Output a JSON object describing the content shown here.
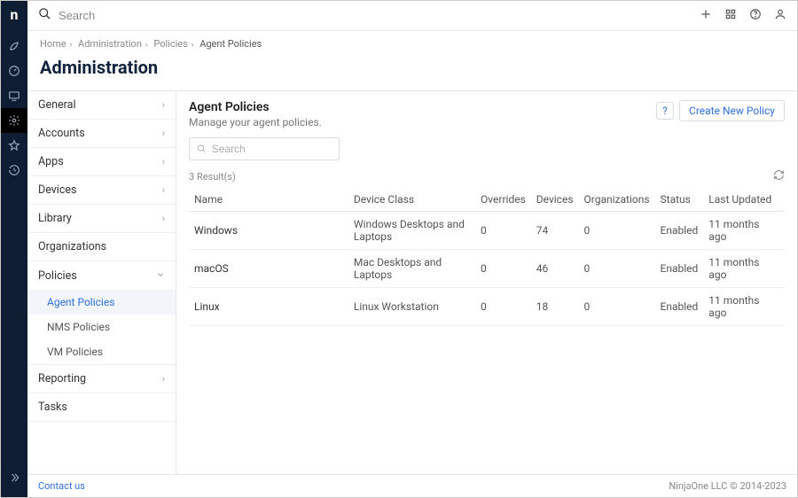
{
  "topbar": {
    "search_placeholder": "Search"
  },
  "breadcrumbs": {
    "home": "Home",
    "admin": "Administration",
    "policies": "Policies",
    "current": "Agent Policies"
  },
  "page_title": "Administration",
  "sidebar": {
    "general": "General",
    "accounts": "Accounts",
    "apps": "Apps",
    "devices": "Devices",
    "library": "Library",
    "organizations": "Organizations",
    "policies": "Policies",
    "agent_policies": "Agent Policies",
    "nms_policies": "NMS Policies",
    "vm_policies": "VM Policies",
    "reporting": "Reporting",
    "tasks": "Tasks"
  },
  "panel": {
    "title": "Agent Policies",
    "subtitle": "Manage your agent policies.",
    "help_label": "?",
    "create_label": "Create New Policy",
    "search_placeholder": "Search",
    "result_count": "3 Result(s)",
    "columns": {
      "name": "Name",
      "device_class": "Device Class",
      "overrides": "Overrides",
      "devices": "Devices",
      "organizations": "Organizations",
      "status": "Status",
      "last_updated": "Last Updated"
    },
    "rows": [
      {
        "name": "Windows",
        "device_class": "Windows Desktops and Laptops",
        "overrides": "0",
        "devices": "74",
        "organizations": "0",
        "status": "Enabled",
        "last_updated": "11 months ago"
      },
      {
        "name": "macOS",
        "device_class": "Mac Desktops and Laptops",
        "overrides": "0",
        "devices": "46",
        "organizations": "0",
        "status": "Enabled",
        "last_updated": "11 months ago"
      },
      {
        "name": "Linux",
        "device_class": "Linux Workstation",
        "overrides": "0",
        "devices": "18",
        "organizations": "0",
        "status": "Enabled",
        "last_updated": "11 months ago"
      }
    ]
  },
  "footer": {
    "contact": "Contact us",
    "copyright": "NinjaOne LLC © 2014-2023"
  }
}
